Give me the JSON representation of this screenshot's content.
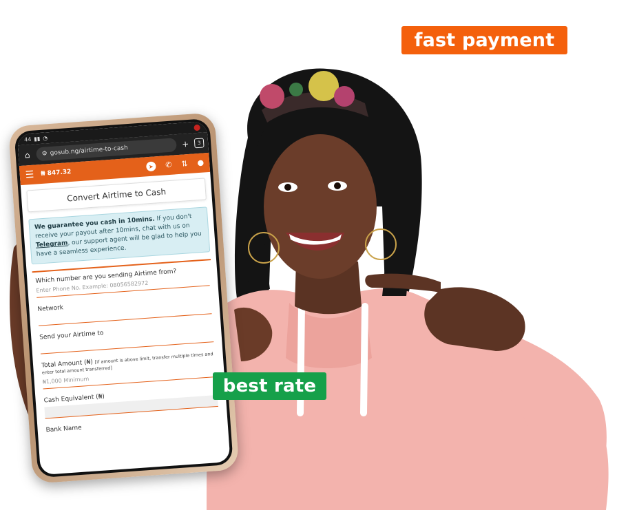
{
  "badges": {
    "fast_payment": "fast payment",
    "best_rate": "best rate"
  },
  "colors": {
    "orange_badge": "#f4600c",
    "green_badge": "#16a04a",
    "app_bar": "#e4611a",
    "hoodie": "#f3b3ad"
  },
  "phone": {
    "status_time": "44",
    "url": "gosub.ng/airtime-to-cash",
    "tab_count": "3",
    "balance": "₦ 847.32",
    "page_title": "Convert Airtime to Cash",
    "notice": {
      "bold": "We guarantee you cash in 10mins.",
      "text_1": " If you don't receive your payout after 10mins, chat with us on ",
      "link": "Telegram",
      "text_2": ", our support agent will be glad to help you have a seamless experience."
    },
    "fields": {
      "phone_label": "Which number are you sending Airtime from?",
      "phone_placeholder": "Enter Phone No. Example: 08056582972",
      "network_label": "Network",
      "send_to_label": "Send your Airtime to",
      "amount_label": "Total Amount (₦)",
      "amount_note": "[if amount is above limit, transfer multiple times and enter total amount transferred]",
      "amount_placeholder": "₦1,000 Minimum",
      "cash_label": "Cash Equivalent (₦)",
      "bank_label": "Bank Name"
    }
  }
}
